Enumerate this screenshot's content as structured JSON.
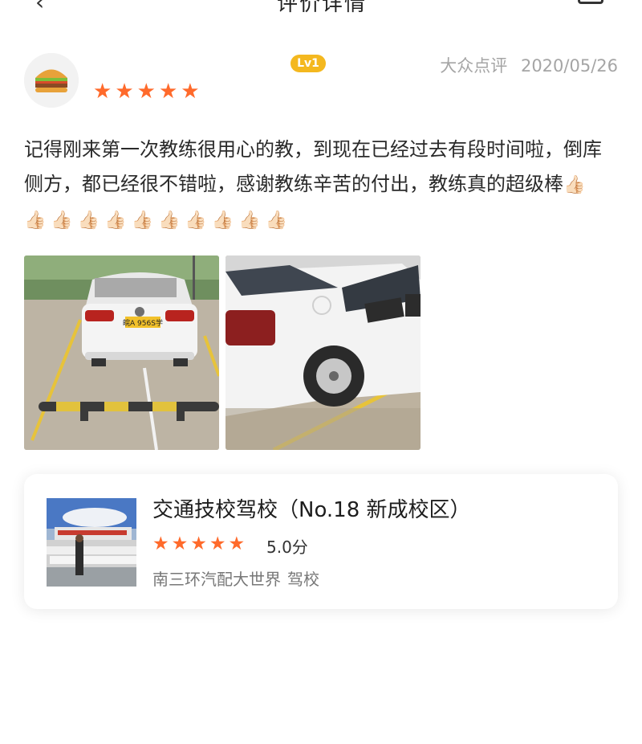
{
  "header": {
    "title_partial": "评价详情",
    "back_icon": "back-arrow-icon",
    "menu_icon": "more-icon"
  },
  "review": {
    "avatar_icon": "burger-avatar-icon",
    "rating": 5,
    "level_badge": "Lv1",
    "source": "大众点评",
    "date": "2020/05/26",
    "text": "记得刚来第一次教练很用心的教，到现在已经过去有段时间啦，倒库侧方，都已经很不错啦，感谢教练辛苦的付出，教练真的超级棒",
    "thumbs_emoji_count": 11,
    "thumbs_emoji": "👍🏻👍🏻👍🏻👍🏻👍🏻👍🏻👍🏻👍🏻👍🏻👍🏻👍🏻",
    "photos": [
      {
        "alt": "white-car-rear-photo",
        "plate": "皖A 956S学"
      },
      {
        "alt": "white-car-side-photo"
      }
    ]
  },
  "shop": {
    "name": "交通技校驾校（No.18 新成校区）",
    "rating": 5,
    "score": "5.0分",
    "area": "南三环汽配大世界",
    "category": "驾校",
    "colors": {
      "star": "#ff6a2b",
      "badge": "#f4b81f"
    }
  }
}
